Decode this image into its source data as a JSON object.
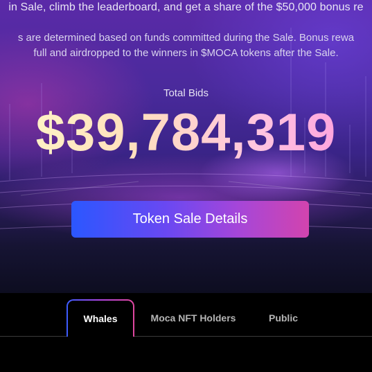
{
  "hero": {
    "intro_line": "in Sale, climb the leaderboard, and get a share of the $50,000 bonus re",
    "description_line1": "s are determined based on funds committed during the Sale. Bonus rewa",
    "description_line2": "full and airdropped to the winners in $MOCA tokens after the Sale.",
    "total_label": "Total Bids",
    "total_amount": "$39,784,319",
    "cta_label": "Token Sale Details"
  },
  "tabs": [
    {
      "label": "Whales",
      "active": true
    },
    {
      "label": "Moca NFT Holders",
      "active": false
    },
    {
      "label": "Public",
      "active": false
    }
  ],
  "colors": {
    "accent_start": "#2b57ff",
    "accent_end": "#d244ae",
    "amount_start": "#fff8c8",
    "amount_end": "#ff97dc"
  }
}
